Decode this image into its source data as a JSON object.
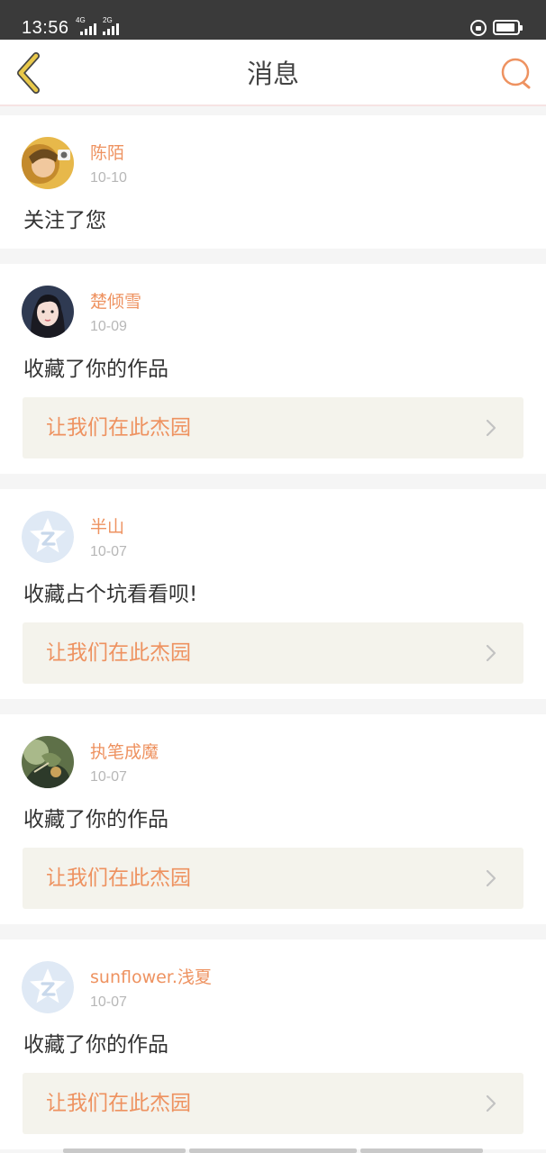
{
  "status_bar": {
    "time": "13:56",
    "network_1": "4G",
    "network_2": "2G",
    "icons": [
      "signal-icon",
      "signal-icon",
      "screen-lock-icon",
      "battery-icon"
    ]
  },
  "header": {
    "title": "消息",
    "back_icon": "back-arrow-icon",
    "search_icon": "search-icon"
  },
  "colors": {
    "accent": "#ee9260",
    "back_arrow": "#e8c84a",
    "link_background": "#f4f3ec",
    "default_avatar": "#dfe9f5"
  },
  "messages": [
    {
      "user": "陈陌",
      "date": "10-10",
      "text": "关注了您",
      "avatar": "photo-avatar"
    },
    {
      "user": "楚倾雪",
      "date": "10-09",
      "text": "收藏了你的作品",
      "work_title": "让我们在此杰园",
      "avatar": "photo-avatar"
    },
    {
      "user": "半山",
      "date": "10-07",
      "text": "收藏占个坑看看呗!",
      "work_title": "让我们在此杰园",
      "avatar": "default-avatar-icon"
    },
    {
      "user": "执笔成魔",
      "date": "10-07",
      "text": "收藏了你的作品",
      "work_title": "让我们在此杰园",
      "avatar": "photo-avatar"
    },
    {
      "user": "sunflower.浅夏",
      "date": "10-07",
      "text": "收藏了你的作品",
      "work_title": "让我们在此杰园",
      "avatar": "default-avatar-icon"
    }
  ]
}
